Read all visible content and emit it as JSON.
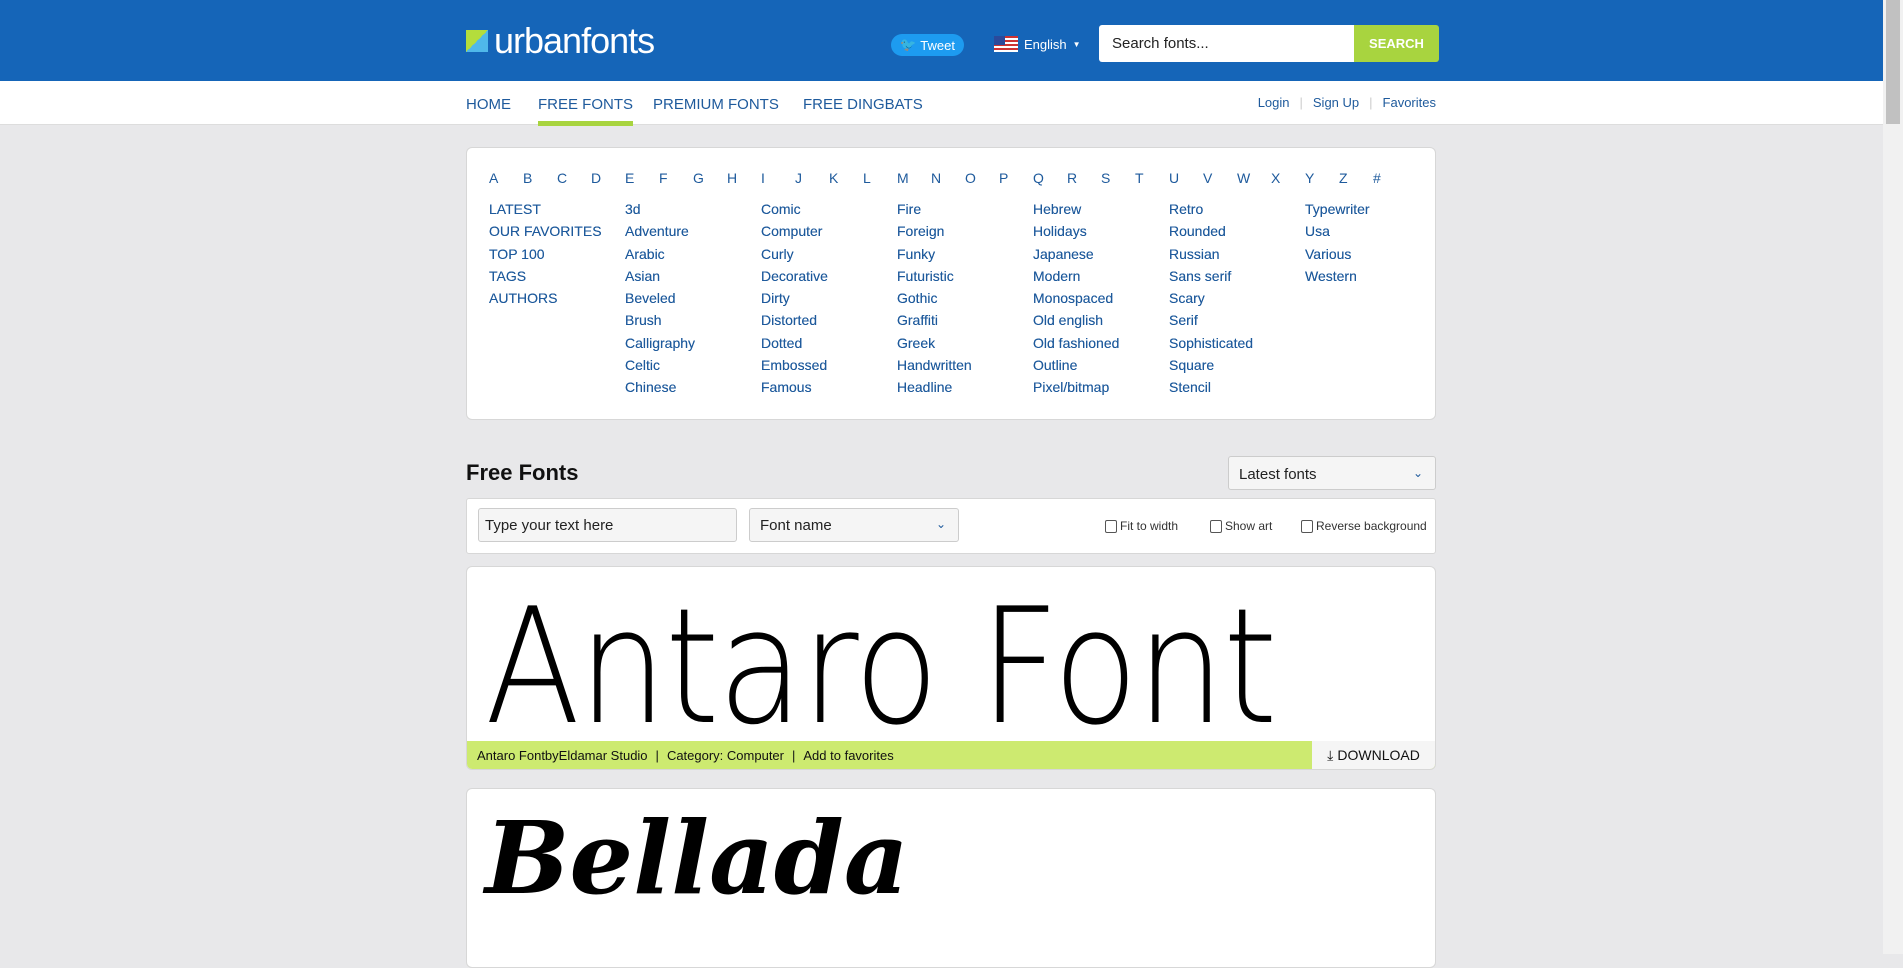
{
  "header": {
    "logo": "urbanfonts",
    "tweet": "Tweet",
    "language": "English",
    "search_placeholder": "Search fonts...",
    "search_button": "SEARCH"
  },
  "nav": {
    "items": [
      "HOME",
      "FREE FONTS",
      "PREMIUM FONTS",
      "FREE DINGBATS"
    ],
    "active": "FREE FONTS",
    "login": "Login",
    "signup": "Sign Up",
    "favorites": "Favorites"
  },
  "letters": [
    "A",
    "B",
    "C",
    "D",
    "E",
    "F",
    "G",
    "H",
    "I",
    "J",
    "K",
    "L",
    "M",
    "N",
    "O",
    "P",
    "Q",
    "R",
    "S",
    "T",
    "U",
    "V",
    "W",
    "X",
    "Y",
    "Z",
    "#"
  ],
  "columns": [
    [
      "LATEST",
      "OUR FAVORITES",
      "TOP 100",
      "TAGS",
      "AUTHORS"
    ],
    [
      "3d",
      "Adventure",
      "Arabic",
      "Asian",
      "Beveled",
      "Brush",
      "Calligraphy",
      "Celtic",
      "Chinese"
    ],
    [
      "Comic",
      "Computer",
      "Curly",
      "Decorative",
      "Dirty",
      "Distorted",
      "Dotted",
      "Embossed",
      "Famous"
    ],
    [
      "Fire",
      "Foreign",
      "Funky",
      "Futuristic",
      "Gothic",
      "Graffiti",
      "Greek",
      "Handwritten",
      "Headline"
    ],
    [
      "Hebrew",
      "Holidays",
      "Japanese",
      "Modern",
      "Monospaced",
      "Old english",
      "Old fashioned",
      "Outline",
      "Pixel/bitmap"
    ],
    [
      "Retro",
      "Rounded",
      "Russian",
      "Sans serif",
      "Scary",
      "Serif",
      "Sophisticated",
      "Square",
      "Stencil"
    ],
    [
      "Typewriter",
      "Usa",
      "Various",
      "Western"
    ]
  ],
  "main": {
    "title": "Free Fonts",
    "sort": "Latest fonts",
    "text_placeholder": "Type your text here",
    "font_name": "Font name",
    "fit_to_width": "Fit to width",
    "show_art": "Show art",
    "reverse_background": "Reverse background"
  },
  "fonts": [
    {
      "sample": "Antaro Font",
      "info": "Antaro FontbyEldamar Studio",
      "category": "Category: Computer",
      "favorite": "Add to favorites",
      "download": "DOWNLOAD"
    },
    {
      "sample": "Bellada"
    }
  ],
  "colors": {
    "brand": "#1565b8",
    "accent": "#a8d43f",
    "info_bar": "#cdea70",
    "link": "#1e5a9c"
  }
}
